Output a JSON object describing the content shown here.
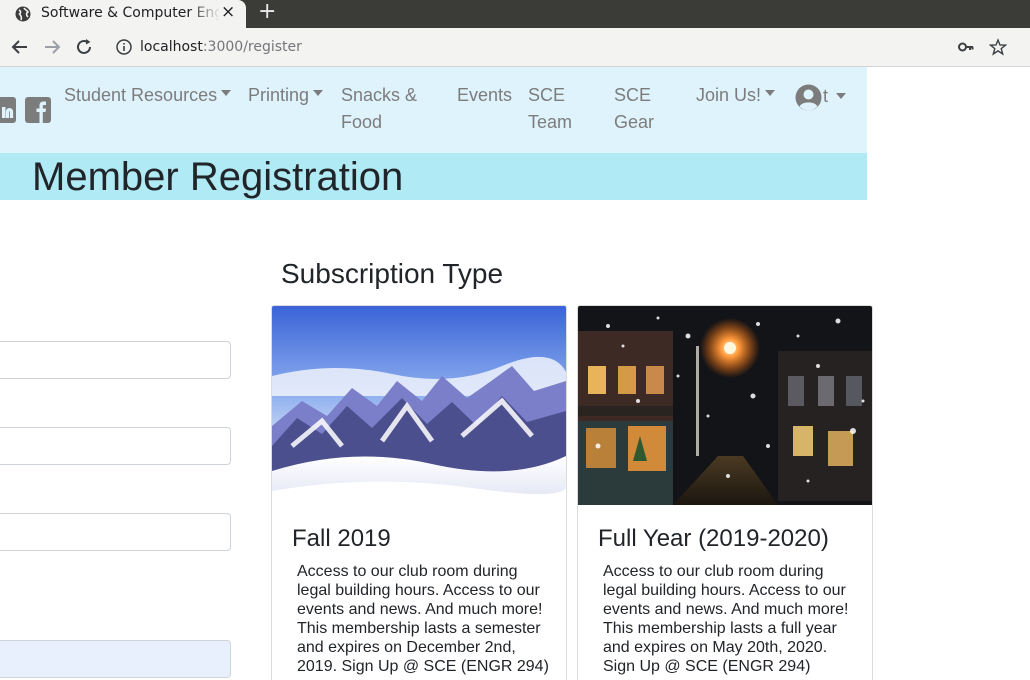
{
  "browser": {
    "tab_title": "Software & Computer Engineering Society",
    "tab_close": "×",
    "new_tab": "+",
    "url_host": "localhost",
    "url_path": ":3000/register"
  },
  "navbar": {
    "items": [
      {
        "label": "Student Resources",
        "dropdown": true
      },
      {
        "label": "Printing",
        "dropdown": true
      },
      {
        "label": "Snacks &\nFood",
        "dropdown": false
      },
      {
        "label": "Events",
        "dropdown": false
      },
      {
        "label": "SCE\nTeam",
        "dropdown": false
      },
      {
        "label": "SCE\nGear",
        "dropdown": false
      },
      {
        "label": "Join Us!",
        "dropdown": true
      }
    ],
    "user_initial": "t",
    "social_icons": [
      "linkedin-icon",
      "facebook-icon"
    ]
  },
  "page": {
    "title": "Member Registration",
    "subscription_heading": "Subscription Type"
  },
  "plans": [
    {
      "title": "Fall 2019",
      "description": "Access to our club room during legal building hours. Access to our events and news. And much more! This membership lasts a semester and expires on December 2nd, 2019. Sign Up @ SCE (ENGR 294)",
      "image": "snowy-mountains-image"
    },
    {
      "title": "Full Year (2019-2020)",
      "description": "Access to our club room during legal building hours. Access to our events and news. And much more! This membership lasts a full year and expires on May 20th, 2020. Sign Up @ SCE (ENGR 294)",
      "image": "snowy-street-night-image"
    }
  ],
  "colors": {
    "navbar_bg": "#dff3fd",
    "title_bar_bg": "#b0eaf5",
    "nav_text": "#7c7c7c",
    "autofill_bg": "#e8f0fe"
  }
}
